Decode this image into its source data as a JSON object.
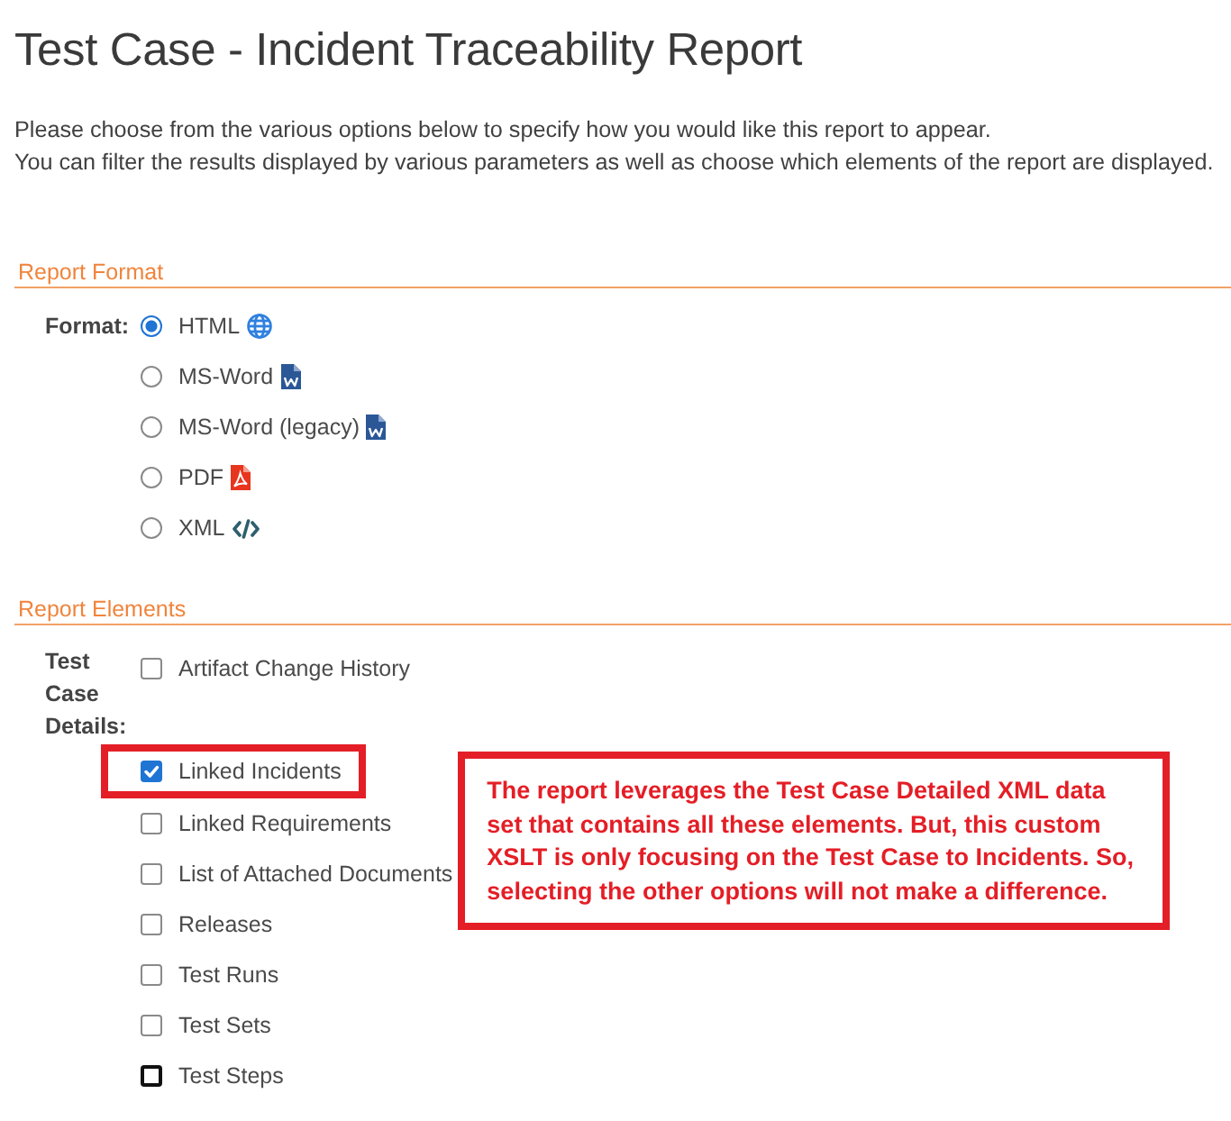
{
  "page": {
    "title": "Test Case - Incident Traceability Report",
    "intro": [
      "Please choose from the various options below to specify how you would like this report to appear.",
      "You can filter the results displayed by various parameters as well as choose which elements of the report are displayed."
    ]
  },
  "report_format": {
    "heading": "Report Format",
    "label": "Format:",
    "options": [
      {
        "label": "HTML",
        "kind": "globe",
        "selected": true
      },
      {
        "label": "MS-Word",
        "kind": "word",
        "selected": false
      },
      {
        "label": "MS-Word (legacy)",
        "kind": "word",
        "selected": false
      },
      {
        "label": "PDF",
        "kind": "pdf",
        "selected": false
      },
      {
        "label": "XML",
        "kind": "code",
        "selected": false
      }
    ]
  },
  "report_elements": {
    "heading": "Report Elements",
    "groups": [
      {
        "label": "Test Case Details:",
        "items": [
          {
            "label": "Artifact Change History",
            "checked": false,
            "highlighted": false,
            "focused": false
          },
          {
            "label": "Linked Incidents",
            "checked": true,
            "highlighted": true,
            "focused": false
          },
          {
            "label": "Linked Requirements",
            "checked": false,
            "highlighted": false,
            "focused": false
          },
          {
            "label": "List of Attached Documents",
            "checked": false,
            "highlighted": false,
            "focused": false
          },
          {
            "label": "Releases",
            "checked": false,
            "highlighted": false,
            "focused": false
          },
          {
            "label": "Test Runs",
            "checked": false,
            "highlighted": false,
            "focused": false
          },
          {
            "label": "Test Sets",
            "checked": false,
            "highlighted": false,
            "focused": false
          },
          {
            "label": "Test Steps",
            "checked": false,
            "highlighted": false,
            "focused": true
          }
        ]
      }
    ]
  },
  "annotation": {
    "text": "The report leverages the Test Case Detailed XML data set that contains all these elements. But, this custom XSLT is only focusing on the Test Case to Incidents. So, selecting the other options will not make a difference."
  }
}
